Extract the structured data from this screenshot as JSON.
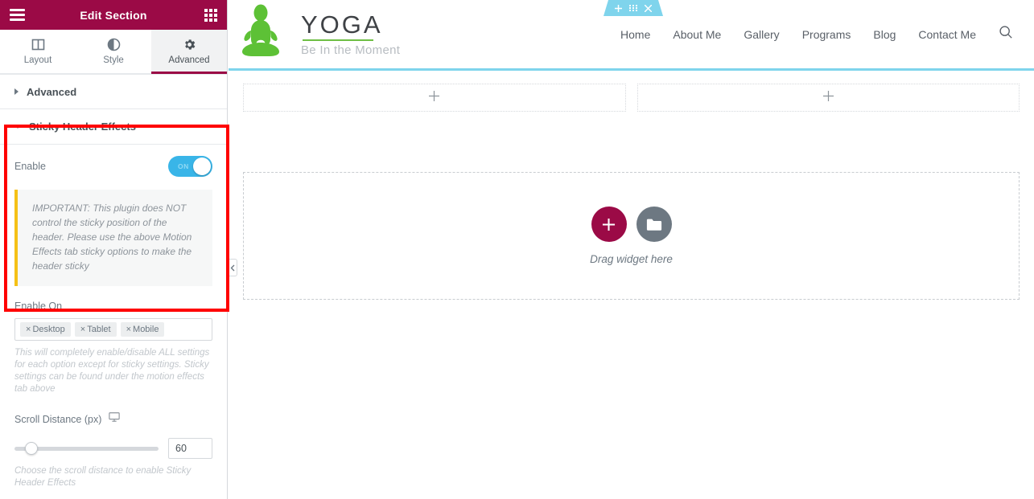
{
  "panel": {
    "header": {
      "title": "Edit Section",
      "menu_icon": "hamburger-icon",
      "apps_icon": "apps-grid-icon"
    },
    "tabs": [
      {
        "label": "Layout",
        "icon": "layout-columns-icon",
        "active": false
      },
      {
        "label": "Style",
        "icon": "contrast-circle-icon",
        "active": false
      },
      {
        "label": "Advanced",
        "icon": "gear-icon",
        "active": true
      }
    ],
    "sections": {
      "advanced": {
        "label": "Advanced",
        "expanded": false
      },
      "sticky_header_effects": {
        "label": "Sticky Header Effects",
        "expanded": true,
        "enable": {
          "label": "Enable",
          "value": "ON",
          "state": true
        },
        "notice": "IMPORTANT: This plugin does NOT control the sticky position of the header. Please use the above Motion Effects tab sticky options to make the header sticky",
        "enable_on": {
          "label": "Enable On",
          "tags": [
            "Desktop",
            "Tablet",
            "Mobile"
          ],
          "remove_glyph": "×",
          "help": "This will completely enable/disable ALL settings for each option except for sticky settings. Sticky settings can be found under the motion effects tab above"
        },
        "scroll_distance": {
          "label": "Scroll Distance (px)",
          "device_icon": "desktop-monitor-icon",
          "value": "60",
          "slider_percent": 12,
          "help": "Choose the scroll distance to enable Sticky Header Effects"
        }
      }
    },
    "collapse_icon": "chevron-left-icon"
  },
  "annotation": {
    "type": "red-rectangle-highlight",
    "color": "#ff0000"
  },
  "preview": {
    "section_toolbar": {
      "add_icon": "plus-icon",
      "drag_icon": "drag-handle-icon",
      "close_icon": "close-icon"
    },
    "site": {
      "logo_icon": "yoga-meditation-figure-icon",
      "brand_name": "YOGA",
      "tagline": "Be In the Moment",
      "nav": [
        "Home",
        "About Me",
        "Gallery",
        "Programs",
        "Blog",
        "Contact Me"
      ],
      "search_icon": "search-icon"
    },
    "columns": [
      {
        "add_icon": "plus-icon"
      },
      {
        "add_icon": "plus-icon"
      }
    ],
    "drop_zone": {
      "add_icon": "plus-icon",
      "folder_icon": "folder-icon",
      "text": "Drag widget here"
    }
  },
  "colors": {
    "panel_header": "#9b0a46",
    "accent_crimson": "#9b0a46",
    "toggle_on": "#39b5e8",
    "preview_accent": "#7fd4ec",
    "logo_green": "#6ebe44",
    "notice_bar": "#f5c116",
    "annotation_red": "#ff0000"
  }
}
